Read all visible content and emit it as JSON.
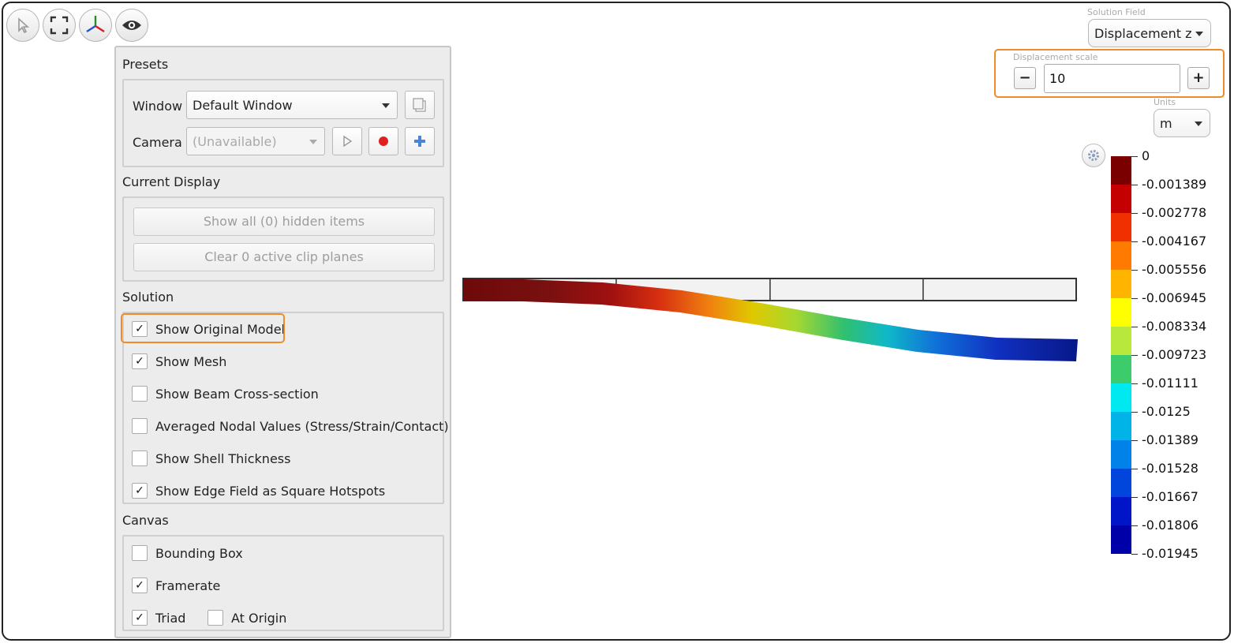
{
  "presets": {
    "title": "Presets",
    "window_label": "Window",
    "window_value": "Default Window",
    "camera_label": "Camera",
    "camera_value": "(Unavailable)"
  },
  "current_display": {
    "title": "Current Display",
    "show_hidden": "Show all (0) hidden items",
    "clear_clip": "Clear 0 active clip planes"
  },
  "solution": {
    "title": "Solution",
    "items": [
      {
        "label": "Show Original Model",
        "checked": true
      },
      {
        "label": "Show Mesh",
        "checked": true
      },
      {
        "label": "Show Beam Cross-section",
        "checked": false
      },
      {
        "label": "Averaged Nodal Values (Stress/Strain/Contact)",
        "checked": false
      },
      {
        "label": "Show Shell Thickness",
        "checked": false
      },
      {
        "label": "Show Edge Field as Square Hotspots",
        "checked": true
      }
    ]
  },
  "canvas": {
    "title": "Canvas",
    "items": [
      {
        "label": "Bounding Box",
        "checked": false
      },
      {
        "label": "Framerate",
        "checked": true
      },
      {
        "label": "Triad",
        "checked": true
      },
      {
        "label": "At Origin",
        "checked": false
      }
    ]
  },
  "solution_field": {
    "label": "Solution Field",
    "value": "Displacement z"
  },
  "displacement_scale": {
    "label": "Displacement scale",
    "value": "10",
    "minus": "−",
    "plus": "+"
  },
  "units": {
    "label": "Units",
    "value": "m"
  },
  "legend": {
    "ticks": [
      "0",
      "-0.001389",
      "-0.002778",
      "-0.004167",
      "-0.005556",
      "-0.006945",
      "-0.008334",
      "-0.009723",
      "-0.01111",
      "-0.0125",
      "-0.01389",
      "-0.01528",
      "-0.01667",
      "-0.01806",
      "-0.01945"
    ],
    "colors": [
      "#7a0000",
      "#c40000",
      "#f03000",
      "#ff7a00",
      "#ffb400",
      "#ffff00",
      "#b8e83c",
      "#3ccc6c",
      "#00e8f0",
      "#00b4e8",
      "#0082e8",
      "#0046dc",
      "#0014c8",
      "#0000a8"
    ]
  },
  "colors": {
    "highlight": "#f08c28"
  },
  "icons": {
    "toolbar": [
      "select-cursor-icon",
      "fit-view-icon",
      "triad-axes-icon",
      "eye-icon"
    ],
    "settings": "gear-icon"
  }
}
